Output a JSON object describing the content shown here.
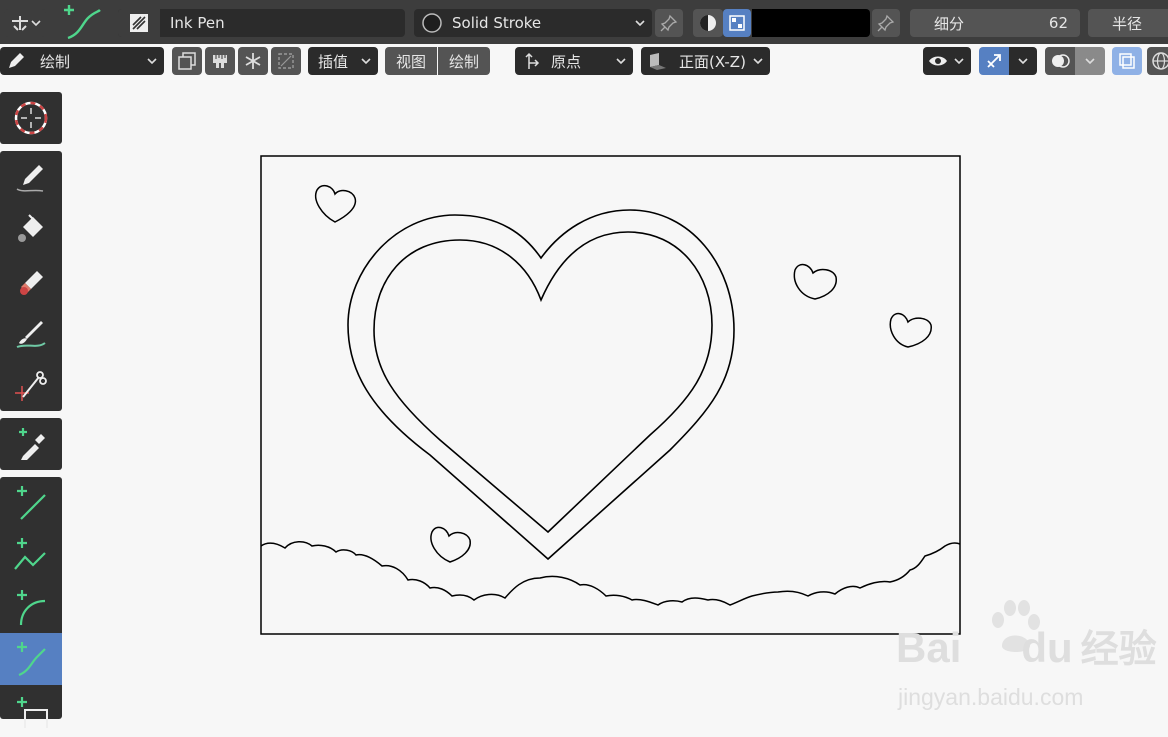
{
  "header": {
    "brush_name": "Ink Pen",
    "material_name": "Solid Stroke",
    "subdivision_label": "细分",
    "subdivision_value": "62",
    "radius_label": "半径",
    "color_swatch": "#000000"
  },
  "toolbar": {
    "mode_label": "绘制",
    "interpolate_label": "插值",
    "view_label": "视图",
    "draw_label": "绘制",
    "origin_label": "原点",
    "plane_label": "正面(X-Z)"
  },
  "tools": [
    {
      "name": "cursor"
    },
    {
      "name": "draw"
    },
    {
      "name": "fill"
    },
    {
      "name": "erase"
    },
    {
      "name": "tint"
    },
    {
      "name": "cutter"
    },
    {
      "name": "eyedropper"
    },
    {
      "name": "line"
    },
    {
      "name": "polyline"
    },
    {
      "name": "arc"
    },
    {
      "name": "curve",
      "active": true
    },
    {
      "name": "box"
    }
  ],
  "watermark": {
    "brand_prefix": "Bai",
    "brand_suffix": "du",
    "brand_cn": "经验",
    "url": "jingyan.baidu.com"
  },
  "colors": {
    "accent": "#5680c2",
    "header_bg": "#3d3d3d",
    "canvas_bg": "#f7f7f7",
    "stroke": "#000000"
  }
}
